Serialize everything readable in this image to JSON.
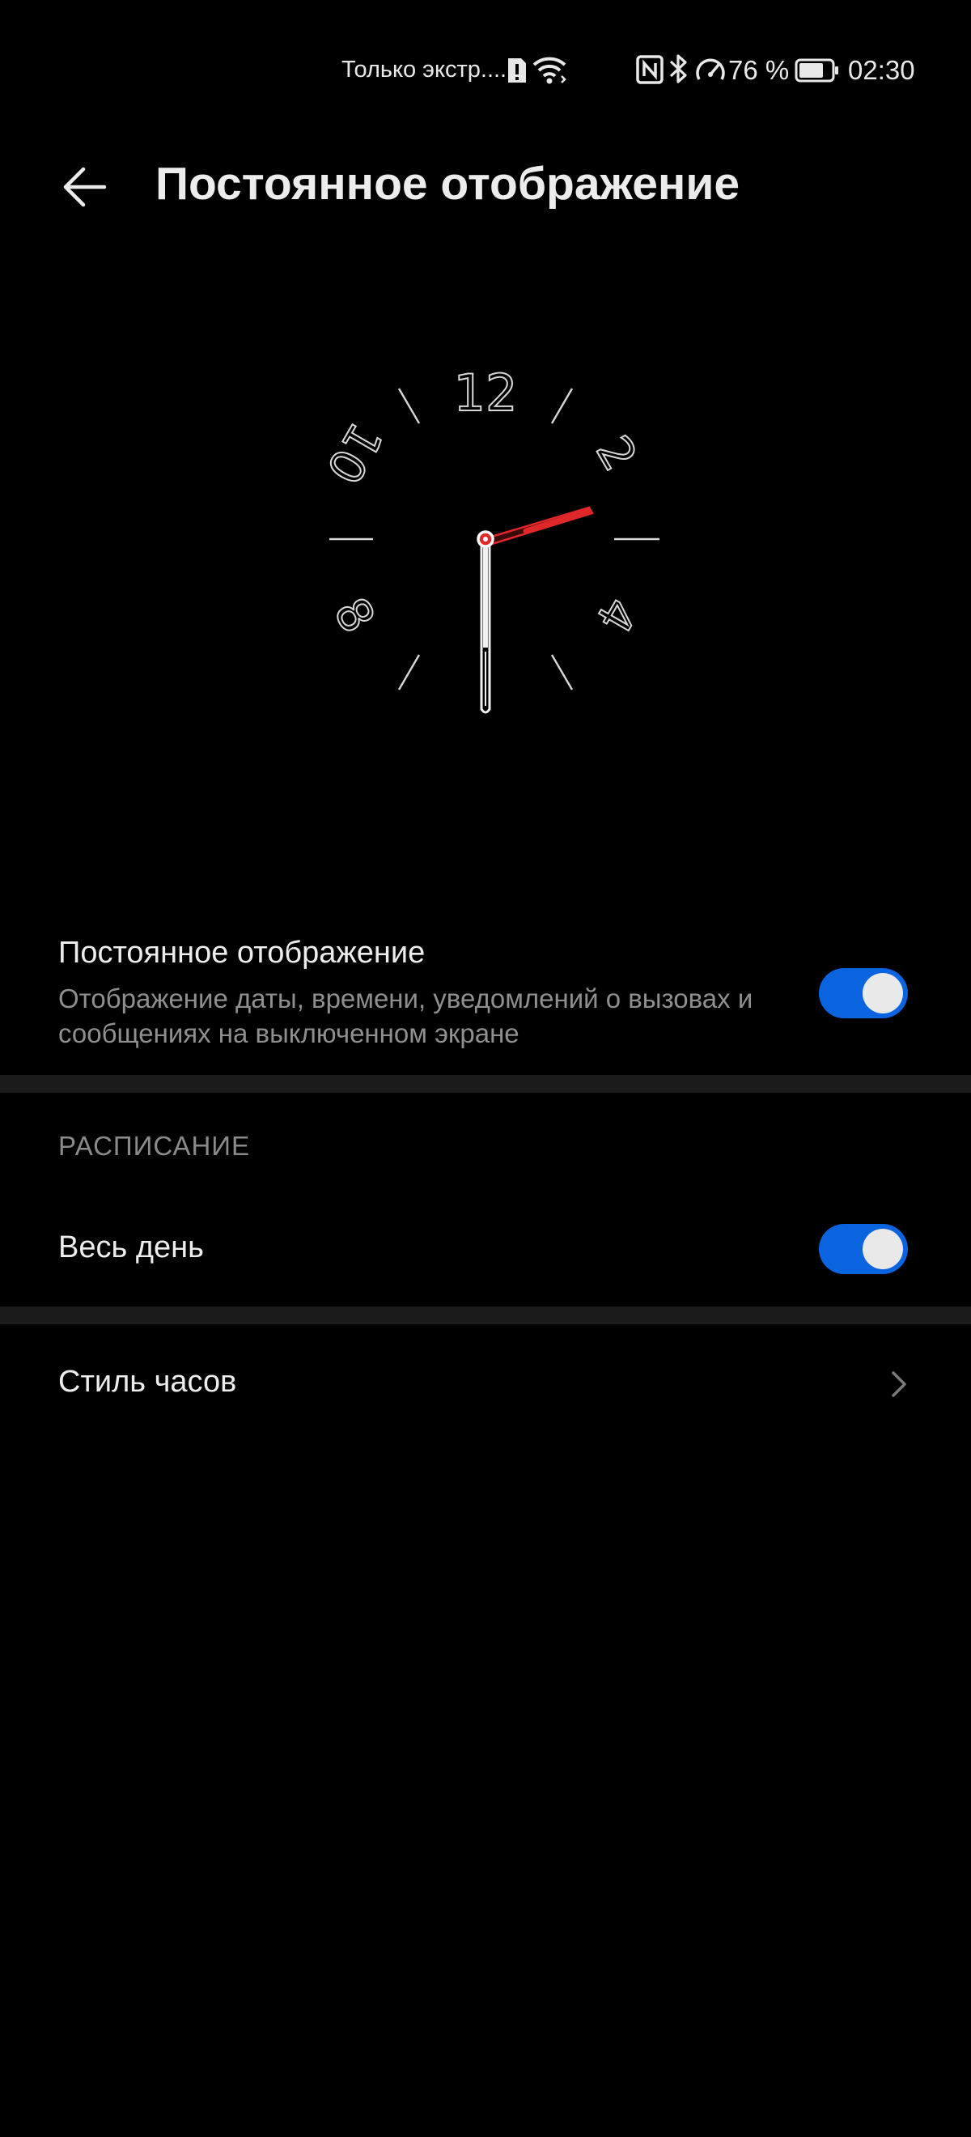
{
  "status_bar": {
    "carrier_text": "Только экстр....",
    "battery_percent": "76 %",
    "time": "02:30",
    "icons": [
      "sim-alert-icon",
      "wifi-icon",
      "nfc-icon",
      "bluetooth-icon",
      "speedometer-icon",
      "battery-icon"
    ],
    "battery_level": 0.76
  },
  "header": {
    "title": "Постоянное отображение",
    "back_icon": "arrow-left-icon"
  },
  "clock_preview": {
    "numerals": [
      "12",
      "2",
      "4",
      "8",
      "10"
    ],
    "hands_time": "02:30",
    "second_hand_color": "#e0282a"
  },
  "always_on": {
    "title": "Постоянное отображение",
    "subtitle": "Отображение даты, времени, уведомлений о вызовах и сообщениях на выключенном экране",
    "enabled": true
  },
  "schedule": {
    "section_label": "РАСПИСАНИЕ",
    "all_day_label": "Весь день",
    "all_day_enabled": true
  },
  "clock_style": {
    "label": "Стиль часов",
    "chevron_icon": "chevron-right-icon"
  },
  "colors": {
    "accent": "#0a64e0",
    "background": "#000000"
  }
}
